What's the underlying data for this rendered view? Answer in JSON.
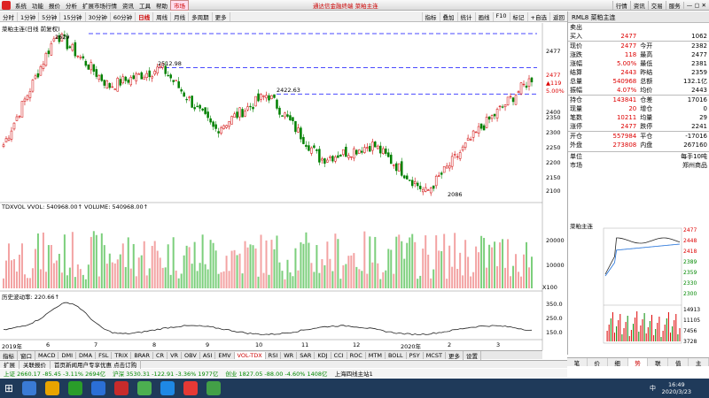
{
  "menubar": {
    "items": [
      "系统",
      "功能",
      "报价",
      "分析",
      "扩展市场行情",
      "资讯",
      "工具",
      "帮助",
      "市场"
    ],
    "brand": "通达信金融终端 菜粕主连",
    "right": [
      "行情",
      "资讯",
      "交易",
      "服务"
    ]
  },
  "toolbar": {
    "periods": [
      "分时",
      "1分钟",
      "5分钟",
      "15分钟",
      "30分钟",
      "60分钟",
      "日线",
      "周线",
      "月线",
      "多周期",
      "更多"
    ],
    "active": "日线",
    "tools": [
      "指标",
      "叠加",
      "统计",
      "画线",
      "F10",
      "标记",
      "+自选",
      "返回"
    ]
  },
  "chart": {
    "title": "菜粕主连(日线 前复权)",
    "price_labels": [
      "2477",
      "2400",
      "2350",
      "2300",
      "2250",
      "2200",
      "2150",
      "2100"
    ],
    "cur_price_marker": [
      "2477",
      "▲119",
      "5.00%"
    ],
    "annotations": [
      "2629",
      "2512.98",
      "2422.63",
      "2086"
    ],
    "volume_title": "TDXVOL VVOL: 540968.00↑  VOLUME: 540968.00↑",
    "volume_ticks": [
      "20000",
      "10000",
      "X100"
    ],
    "vol2_title": "历史波动率: 220.66↑",
    "vol2_ticks": [
      "350.0",
      "250.0",
      "150.0"
    ],
    "x_labels": [
      "2019年",
      "6",
      "7",
      "8",
      "9",
      "10",
      "11",
      "12",
      "2020年",
      "2",
      "3"
    ]
  },
  "chart_data": {
    "type": "line",
    "title": "菜粕主连(日线 前复权)",
    "xlabel": "",
    "ylabel": "",
    "x": [
      "2019年",
      "6",
      "7",
      "8",
      "9",
      "10",
      "11",
      "12",
      "2020年",
      "2",
      "3"
    ],
    "ylim": [
      2086,
      2629
    ],
    "series": [
      {
        "name": "",
        "values": [
          2250,
          2629,
          2450,
          2512.98,
          2300,
          2422.63,
          2200,
          2250,
          2086,
          2300,
          2477
        ]
      }
    ],
    "annotations": [
      "2629",
      "2512.98",
      "2422.63",
      "2086"
    ]
  },
  "bottom_tabs": [
    "指标",
    "窗口",
    "MACD",
    "DMI",
    "DMA",
    "FSL",
    "TRIX",
    "BRAR",
    "CR",
    "VR",
    "OBV",
    "ASI",
    "EMV",
    "VOL-TDX",
    "RSI",
    "WR",
    "SAR",
    "KDJ",
    "CCI",
    "ROC",
    "MTM",
    "BOLL",
    "PSY",
    "MCST",
    "更多",
    "设置"
  ],
  "right_panel": {
    "header": "RML8 菜粕主连",
    "rows": [
      {
        "l": "卖出",
        "lv": "",
        "r": "",
        "rv": ""
      },
      {
        "l": "买入",
        "lv": "2477",
        "r": "",
        "rv": "1062"
      },
      {
        "l": "现价",
        "lv": "2477",
        "r": "今开",
        "rv": "2382"
      },
      {
        "l": "涨跌",
        "lv": "118",
        "r": "最高",
        "rv": "2477"
      },
      {
        "l": "涨幅",
        "lv": "5.00%",
        "r": "最低",
        "rv": "2381"
      },
      {
        "l": "结算",
        "lv": "2443",
        "r": "昨结",
        "rv": "2359"
      },
      {
        "l": "总量",
        "lv": "540968",
        "r": "总额",
        "rv": "132.1亿"
      },
      {
        "l": "振幅",
        "lv": "4.07%",
        "r": "均价",
        "rv": "2443"
      },
      {
        "l": "持仓",
        "lv": "143841",
        "r": "仓差",
        "rv": "17016"
      },
      {
        "l": "现量",
        "lv": "20",
        "r": "增仓",
        "rv": "0"
      },
      {
        "l": "笔数",
        "lv": "10211",
        "r": "均量",
        "rv": "29"
      },
      {
        "l": "涨停",
        "lv": "2477",
        "r": "跌停",
        "rv": "2241"
      },
      {
        "l": "开仓",
        "lv": "557984",
        "r": "平仓",
        "rv": "-17016"
      },
      {
        "l": "外盘",
        "lv": "273808",
        "r": "内盘",
        "rv": "267160"
      }
    ],
    "unit_label": "单位",
    "unit_value": "每手10吨",
    "market_label": "市场",
    "market_value": "郑州商品",
    "mini_title": "菜粕主连",
    "mini_ticks": [
      "2477",
      "2448",
      "2418",
      "2389",
      "2359",
      "2330",
      "2300",
      "14913",
      "11105",
      "7456",
      "3728"
    ],
    "tabs": [
      "笔",
      "价",
      "细",
      "势",
      "联",
      "值",
      "主"
    ]
  },
  "status1": [
    "扩展",
    "关联报价",
    "首页新闻用户专享优惠 点击订购"
  ],
  "status2": [
    "上证 2660.17 -85.45 -3.11% 2694亿",
    "沪深 3530.31 -122.91 -3.36% 1977亿",
    "创业 1827.05 -88.00 -4.60% 1408亿",
    "上海四线主站1"
  ],
  "taskbar": {
    "time": "16:49",
    "date": "2020/3/23",
    "ime": "中"
  },
  "colors": {
    "up": "#d00000",
    "down": "#008000",
    "dash": "#4a4aff"
  }
}
